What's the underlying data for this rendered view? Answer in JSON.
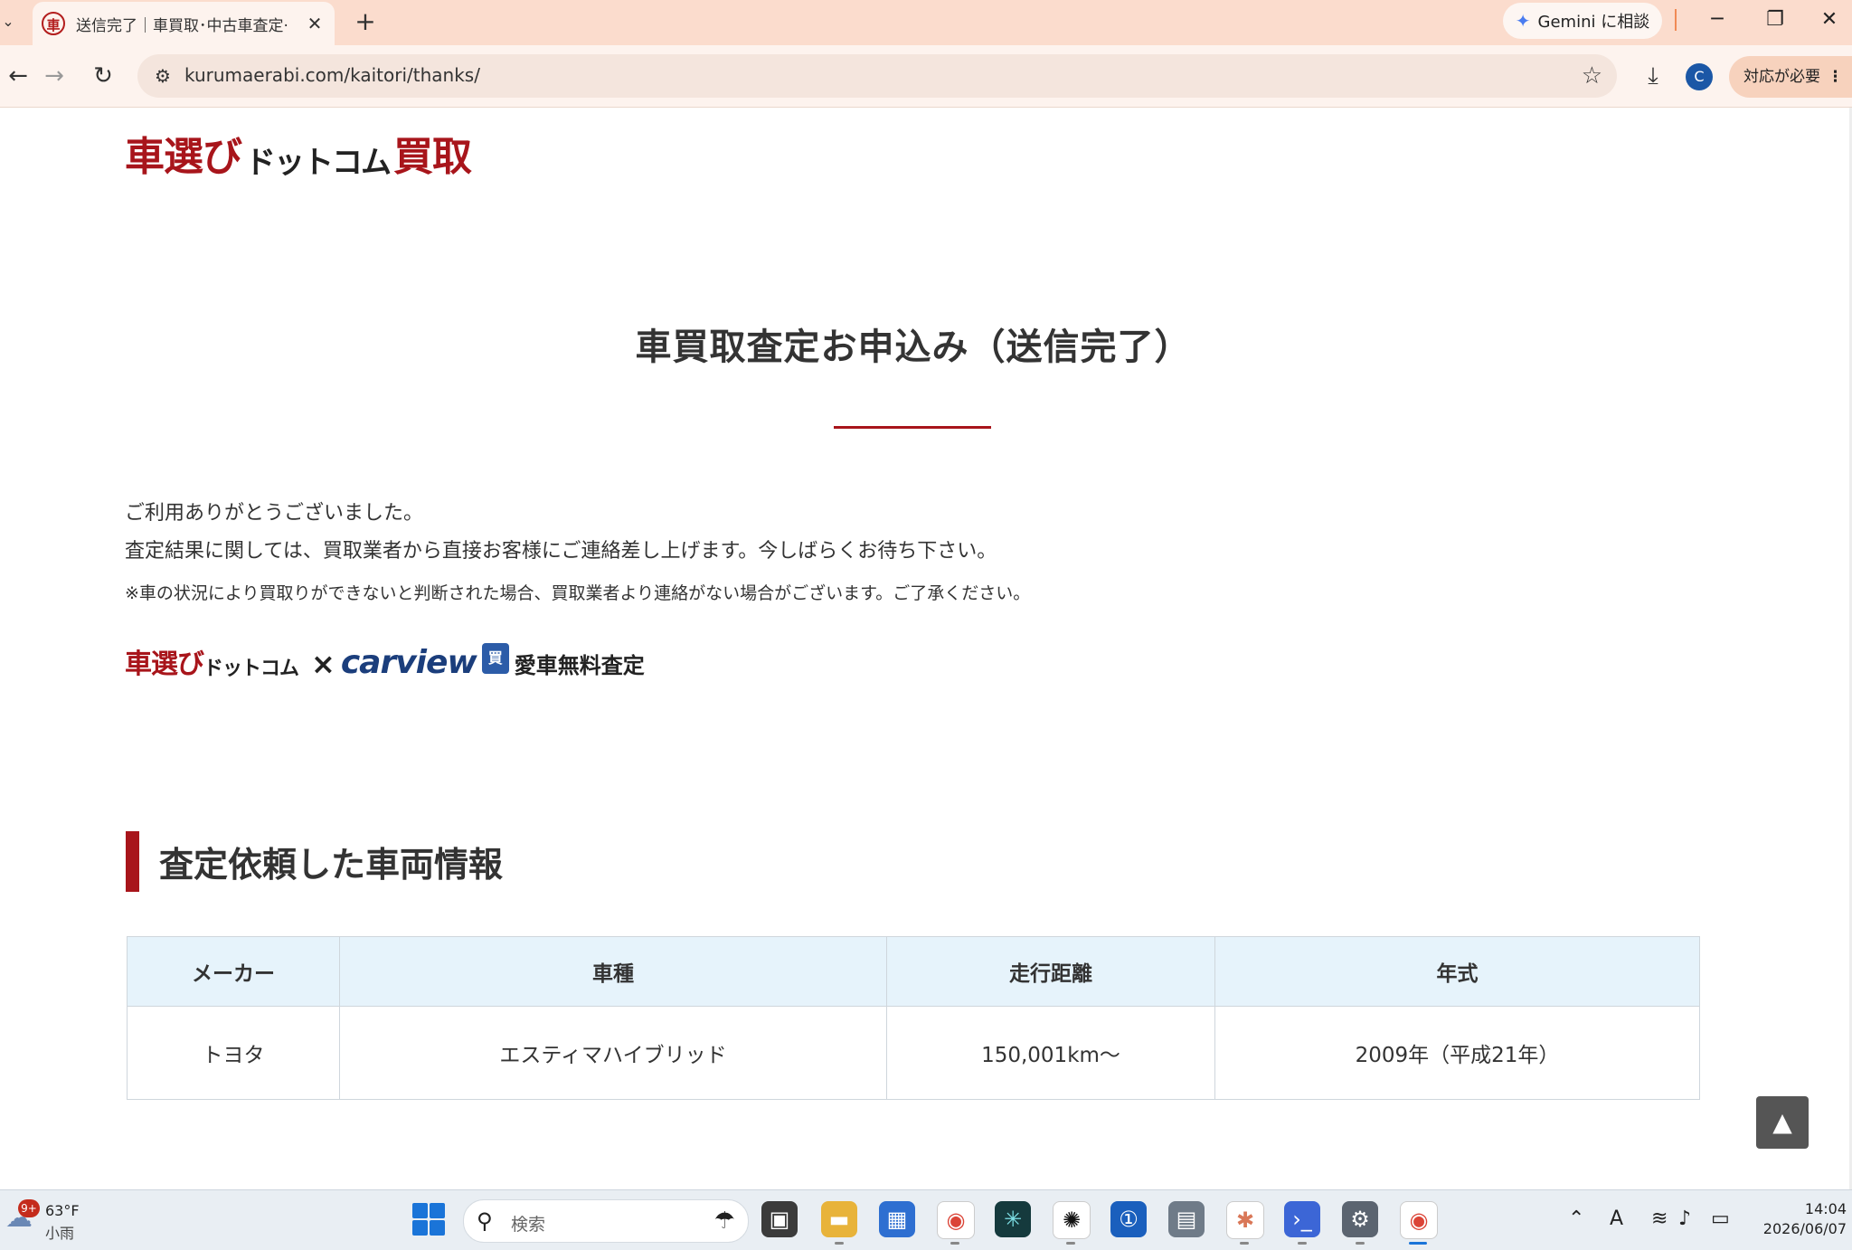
{
  "browser": {
    "tab_menu_icon": "chevron-down",
    "tab_favicon": "車",
    "tab_title": "送信完了｜車買取･中古車査定·",
    "tab_close": "✕",
    "new_tab": "+",
    "gemini_label": "Gemini に相談",
    "minimize": "─",
    "restore": "❐",
    "close": "✕",
    "back": "←",
    "forward": "→",
    "reload": "↻",
    "url": "kurumaerabi.com/kaitori/thanks/",
    "bookmark_star": "☆",
    "download_icon": "⤓",
    "profile_initial": "C",
    "action_needed": "対応が必要",
    "menu_dots": "⋮"
  },
  "page": {
    "logo_part1": "車選び",
    "logo_part2": "ドットコム",
    "logo_part3": "買取",
    "title": "車買取査定お申込み（送信完了）",
    "thanks_line1": "ご利用ありがとうございました。",
    "thanks_line2": "査定結果に関しては、買取業者から直接お客様にご連絡差し上げます。今しばらくお待ち下さい。",
    "note": "※車の状況により買取りができないと判断された場合、買取業者より連絡がない場合がございます。ご了承ください。",
    "partner_part1": "車選び",
    "partner_part2": "ドットコム",
    "partner_x": "×",
    "partner_carview": "carview",
    "partner_badge": "買",
    "partner_sub": "愛車無料査定",
    "section_title": "査定依頼した車両情報",
    "table": {
      "headers": [
        "メーカー",
        "車種",
        "走行距離",
        "年式"
      ],
      "row": [
        "トヨタ",
        "エスティマハイブリッド",
        "150,001km〜",
        "2009年（平成21年）"
      ]
    },
    "to_top": "▲"
  },
  "taskbar": {
    "weather_badge": "9+",
    "weather_temp": "63°F",
    "weather_desc": "小雨",
    "search_placeholder": "検索",
    "clock_time": "14:04",
    "clock_date": "2026/06/07",
    "ime": "A",
    "apps": [
      "task-view",
      "file-explorer",
      "microsoft-store",
      "chrome",
      "perplexity",
      "chatgpt",
      "1password",
      "calculator",
      "claude",
      "terminal",
      "settings",
      "chrome-profile"
    ]
  },
  "colors": {
    "brand_red": "#a8151b",
    "table_header_bg": "#e6f3fb",
    "tab_bar_bg": "#fbdccd"
  }
}
